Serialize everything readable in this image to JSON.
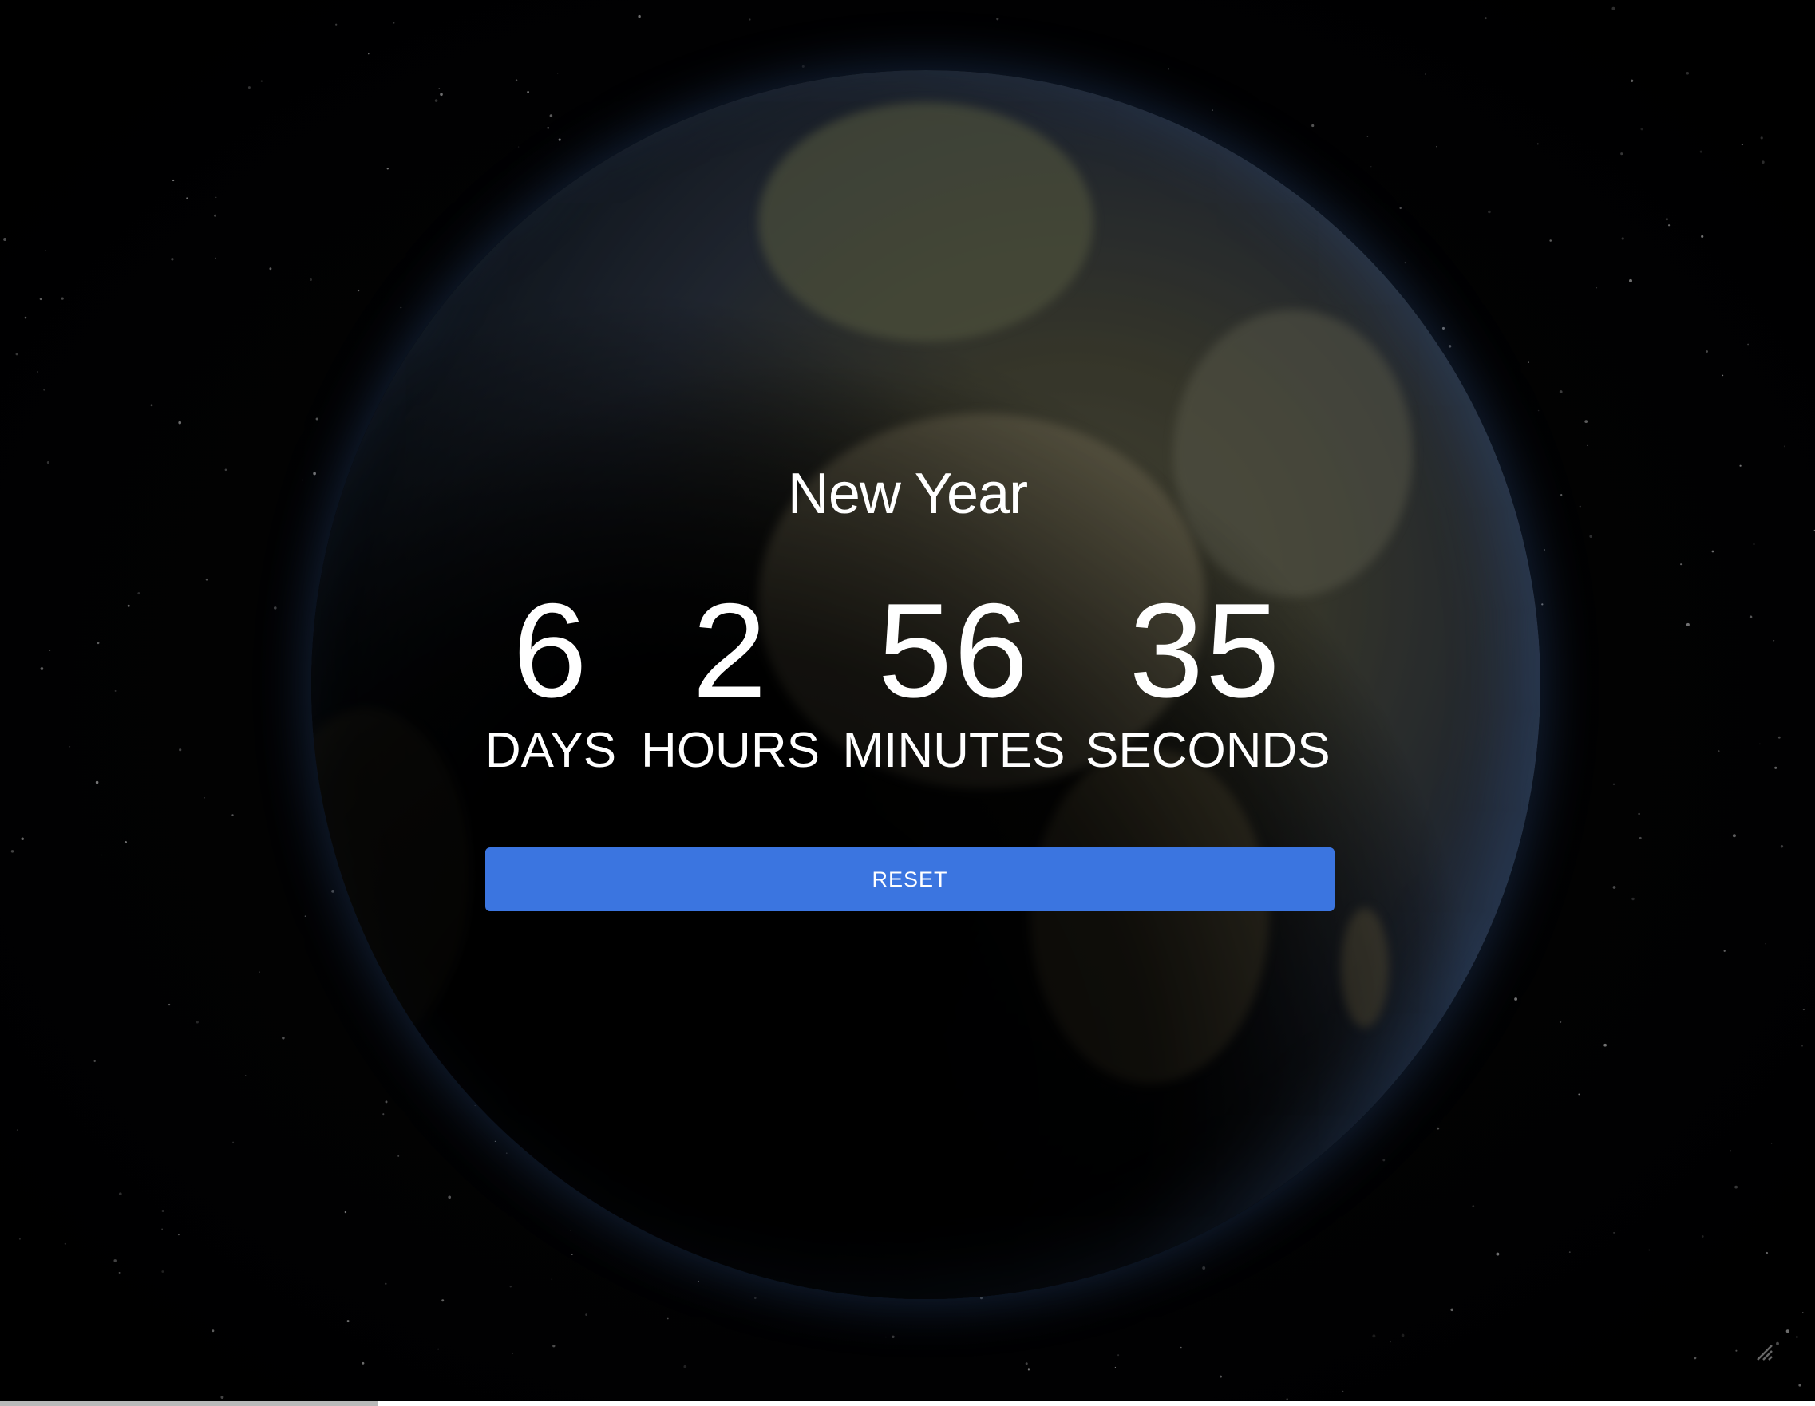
{
  "countdown": {
    "title": "New Year",
    "days": {
      "value": "6",
      "label": "DAYS"
    },
    "hours": {
      "value": "2",
      "label": "HOURS"
    },
    "minutes": {
      "value": "56",
      "label": "MINUTES"
    },
    "seconds": {
      "value": "35",
      "label": "SECONDS"
    }
  },
  "reset_button": {
    "label": "RESET"
  },
  "colors": {
    "button": "#3b75e0",
    "text": "#ffffff",
    "background": "#000000"
  },
  "icons": {
    "corner": "resize-handle-icon"
  }
}
